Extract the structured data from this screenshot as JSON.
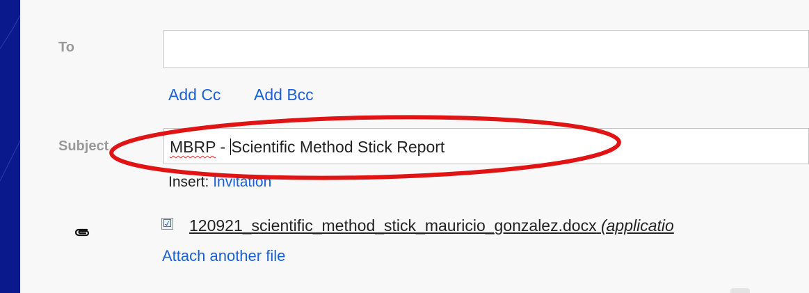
{
  "compose": {
    "to_label": "To",
    "to_value": "",
    "add_cc": "Add Cc",
    "add_bcc": "Add Bcc",
    "subject_label": "Subject",
    "subject_prefix": "MBRP",
    "subject_rest": " - ",
    "subject_after_caret": "Scientific Method Stick Report",
    "insert_label": "Insert:",
    "insert_link": "Invitation",
    "attachment_checked": "☑",
    "attachment_filename": "120921_scientific_method_stick_mauricio_gonzalez.docx",
    "attachment_mime": "(applicatio",
    "attach_another": "Attach another file"
  },
  "icons": {
    "attachment": "paperclip-icon"
  },
  "colors": {
    "background": "#0a1a8c",
    "panel": "#f8f8f8",
    "link": "#1a5fd6",
    "annotation_ellipse": "#e01414"
  }
}
